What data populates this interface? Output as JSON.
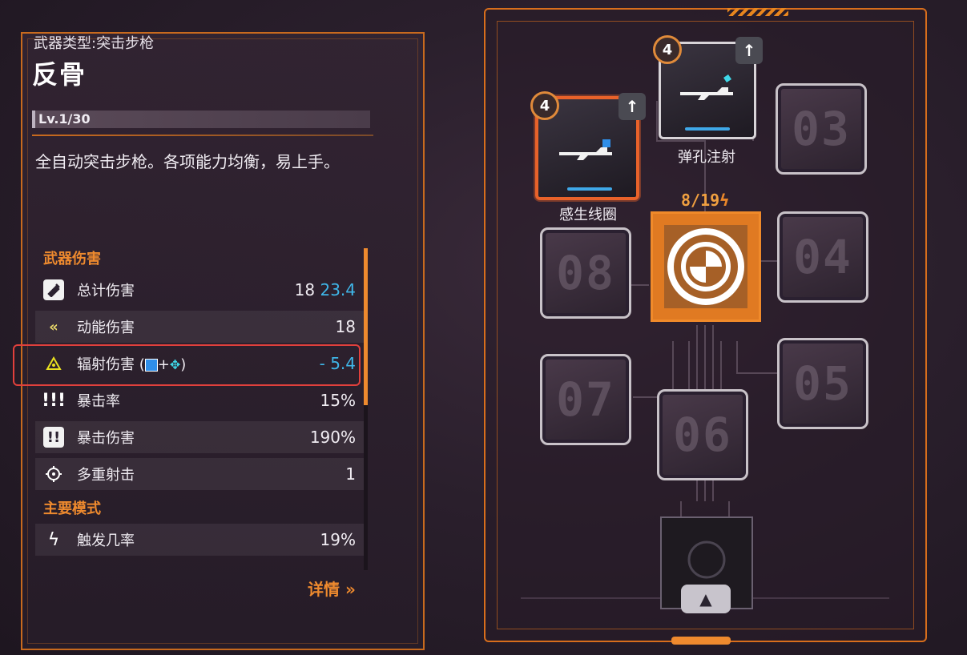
{
  "weapon": {
    "type_label": "武器类型:突击步枪",
    "name": "反骨",
    "level": "Lv.1/30",
    "description": "全自动突击步枪。各项能力均衡，易上手。"
  },
  "stats": {
    "section_damage": "武器伤害",
    "section_mode": "主要模式",
    "total_damage": {
      "label": "总计伤害",
      "value": "18",
      "value_mod": "23.4"
    },
    "kinetic_damage": {
      "label": "动能伤害",
      "value": "18"
    },
    "radiation_damage": {
      "label": "辐射伤害",
      "label_open": "(",
      "plus": "+",
      "label_close": ")",
      "value_prefix": "- ",
      "value": "5.4"
    },
    "crit_rate": {
      "label": "暴击率",
      "value": "15%"
    },
    "crit_damage": {
      "label": "暴击伤害",
      "value": "190%"
    },
    "multishot": {
      "label": "多重射击",
      "value": "1"
    },
    "trigger_chance": {
      "label": "触发几率",
      "value": "19%"
    }
  },
  "details_link": "详情",
  "mods": {
    "capacity": "8/19",
    "slot_left": {
      "name": "感生线圈",
      "rank": "4",
      "upgrade_icon": "arrow-up-icon"
    },
    "slot_top": {
      "name": "弹孔注射",
      "rank": "4",
      "upgrade_icon": "arrow-up-icon"
    },
    "empty_slots": {
      "s03": "03",
      "s04": "04",
      "s05": "05",
      "s06": "06",
      "s07": "07",
      "s08": "08"
    }
  },
  "colors": {
    "accent": "#ee8a2e",
    "highlight": "#e0403c",
    "mod_blue": "#3fb6e8"
  }
}
